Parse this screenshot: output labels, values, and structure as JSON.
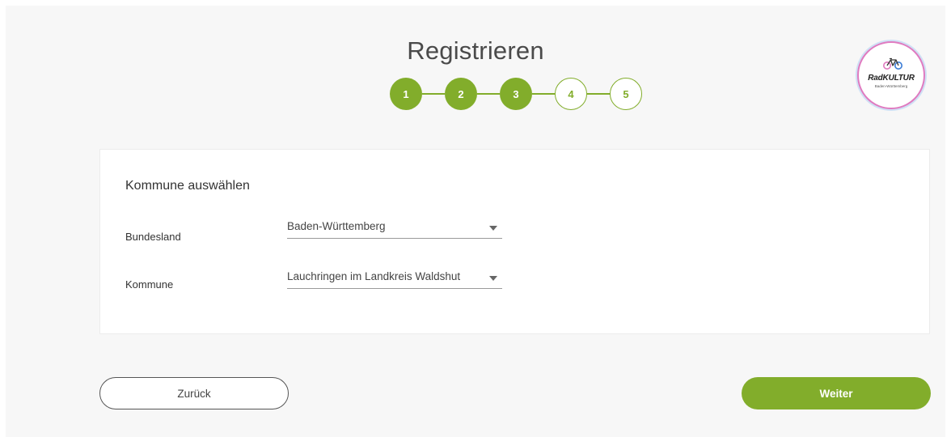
{
  "header": {
    "title": "Registrieren"
  },
  "stepper": {
    "steps": [
      {
        "label": "1",
        "state": "done"
      },
      {
        "label": "2",
        "state": "done"
      },
      {
        "label": "3",
        "state": "done"
      },
      {
        "label": "4",
        "state": "todo"
      },
      {
        "label": "5",
        "state": "todo"
      }
    ]
  },
  "logo": {
    "name": "RadKULTUR",
    "sub": "Baden-Württemberg",
    "icon": "bicycle-icon"
  },
  "form": {
    "title": "Kommune auswählen",
    "fields": [
      {
        "label": "Bundesland",
        "value": "Baden-Württemberg"
      },
      {
        "label": "Kommune",
        "value": "Lauchringen im Landkreis Waldshut"
      }
    ]
  },
  "actions": {
    "back_label": "Zurück",
    "next_label": "Weiter"
  },
  "colors": {
    "accent": "#82ad2b",
    "logo_ring": "#e07bc0"
  }
}
